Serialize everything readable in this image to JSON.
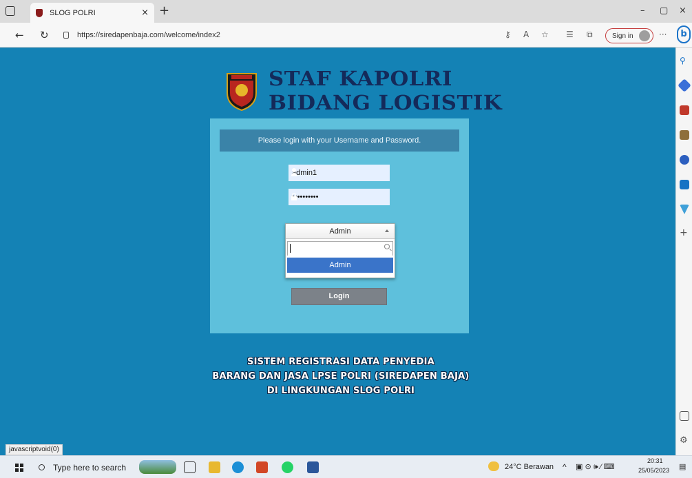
{
  "browser": {
    "tab_title": "SLOG POLRI",
    "tab_close": "×",
    "new_tab": "+",
    "url": "https://siredapenbaja.com/welcome/index2",
    "sign_in": "Sign in",
    "more": "···",
    "bing_letter": "b",
    "minimize": "–",
    "restore": "▢",
    "close": "×"
  },
  "page": {
    "title_line1": "STAF KAPOLRI",
    "title_line2": "BIDANG LOGISTIK",
    "notice": "Please login with your Username and Password.",
    "username_value": "admin1",
    "password_value": "••••••••••",
    "role_select": {
      "selected": "Admin",
      "search_value": "",
      "options": [
        "Admin"
      ]
    },
    "login_button": "Login",
    "footer_lines": [
      "SISTEM REGISTRASI DATA PENYEDIA",
      "BARANG DAN JASA LPSE POLRI (SIREDAPEN BAJA)",
      "DI LINGKUNGAN SLOG POLRI"
    ],
    "status_url": "javascriptvoid(0)"
  },
  "taskbar": {
    "search_placeholder": "Type here to search",
    "weather": "24°C  Berawan",
    "time": "20:31",
    "date": "25/05/2023"
  },
  "colors": {
    "page_bg": "#1482b5",
    "panel_bg": "#5ec0dc",
    "notice_bg": "#3a83a8",
    "title_color": "#142a5a",
    "option_selected": "#3a74c9",
    "login_btn": "#7c8289"
  }
}
